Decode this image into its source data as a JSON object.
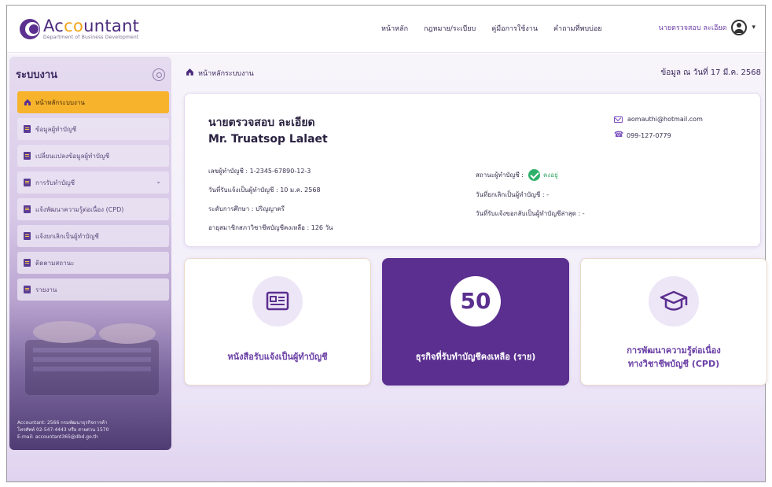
{
  "header": {
    "logo_text_pre": "Ac",
    "logo_text_o": "co",
    "logo_text_post": "untant",
    "logo_sub": "Department of Business Development",
    "nav": [
      "หน้าหลัก",
      "กฎหมาย/ระเบียบ",
      "คู่มือการใช้งาน",
      "คำถามที่พบบ่อย"
    ],
    "user_name": "นายตรวจสอบ ละเอียด"
  },
  "sidebar": {
    "title": "ระบบงาน",
    "items": [
      {
        "label": "หน้าหลักระบบงาน",
        "active": true
      },
      {
        "label": "ข้อมูลผู้ทำบัญชี"
      },
      {
        "label": "เปลี่ยนแปลงข้อมูลผู้ทำบัญชี"
      },
      {
        "label": "การรับทำบัญชี"
      },
      {
        "label": "แจ้งพัฒนาความรู้ต่อเนื่อง (CPD)"
      },
      {
        "label": "แจ้งยกเลิกเป็นผู้ทำบัญชี"
      },
      {
        "label": "ติดตามสถานะ"
      },
      {
        "label": "รายงาน"
      }
    ],
    "footer_lines": [
      "Accountant: 2566 กรมพัฒนาธุรกิจการค้า",
      "โทรศัพท์ 02-547-4443 หรือ สายด่วน 1570",
      "E-mail: accountant365@dbd.go.th"
    ]
  },
  "breadcrumb": "หน้าหลักระบบงาน",
  "date_label": "ข้อมูล ณ วันที่ 17 มี.ค. 2568",
  "profile": {
    "name_th": "นายตรวจสอบ ละเอียด",
    "name_en": "Mr. Truatsop Lalaet",
    "account_id": "เลขผู้ทำบัญชี : 1-2345-67890-12-3",
    "registered_date": "วันที่รับแจ้งเป็นผู้ทำบัญชี : 10 ม.ค. 2568",
    "education": "ระดับการศึกษา : ปริญญาตรี",
    "remaining_days": "อายุสมาชิกสภาวิชาชีพบัญชีคงเหลือ : 126 วัน",
    "status_label": "สถานะผู้ทำบัญชี :",
    "status_value": "คงอยู่",
    "cancel_date": "วันที่ยกเลิกเป็นผู้ทำบัญชี : -",
    "return_date": "วันที่รับแจ้งขอกลับเป็นผู้ทำบัญชีล่าสุด : -",
    "email": "aomauthi@hotmail.com",
    "phone": "099-127-0779"
  },
  "cards": [
    {
      "label": "หนังสือรับแจ้งเป็นผู้ทำบัญชี",
      "icon": "id-card-icon"
    },
    {
      "number": "50",
      "label": "ธุรกิจที่รับทำบัญชีคงเหลือ (ราย)"
    },
    {
      "label_line1": "การพัฒนาความรู้ต่อเนื่อง",
      "label_line2": "ทางวิชาชีพบัญชี (CPD)",
      "icon": "graduation-cap-icon"
    }
  ]
}
